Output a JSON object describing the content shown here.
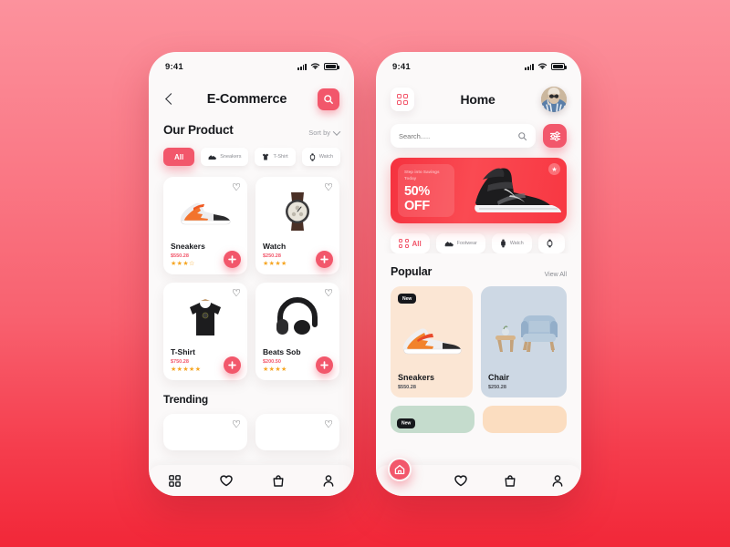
{
  "background": {
    "gradient_from": "#FC929D",
    "gradient_to": "#F22738"
  },
  "accent": "#F2576B",
  "star_color": "#F6A623",
  "left_phone": {
    "status_bar": {
      "time": "9:41",
      "signal_icon": "signal-bars-icon",
      "wifi_icon": "wifi-icon",
      "battery_icon": "battery-icon"
    },
    "header": {
      "back_icon": "chevron-left-icon",
      "title": "E-Commerce",
      "search_icon": "search-icon"
    },
    "section": {
      "title": "Our Product",
      "sort_label": "Sort by",
      "sort_chevron_icon": "chevron-down-icon"
    },
    "chips": [
      {
        "label": "All",
        "icon": "",
        "active": true
      },
      {
        "label": "Sneakers",
        "icon": "sneaker-icon",
        "active": false
      },
      {
        "label": "T-Shirt",
        "icon": "tshirt-icon",
        "active": false
      },
      {
        "label": "Watch",
        "icon": "watch-icon",
        "active": false
      }
    ],
    "products": [
      {
        "name": "Sneakers",
        "price": "$550.28",
        "stars": "★★★☆",
        "thumb": "sneaker-photo",
        "heart_icon": "heart-outline-icon",
        "add_icon": "plus-icon"
      },
      {
        "name": "Watch",
        "price": "$250.28",
        "stars": "★★★★",
        "thumb": "watch-photo",
        "heart_icon": "heart-outline-icon",
        "add_icon": "plus-icon"
      },
      {
        "name": "T-Shirt",
        "price": "$750.28",
        "stars": "★★★★★",
        "thumb": "tshirt-photo",
        "heart_icon": "heart-outline-icon",
        "add_icon": "plus-icon"
      },
      {
        "name": "Beats Sob",
        "price": "$200.50",
        "stars": "★★★★",
        "thumb": "headphones-photo",
        "heart_icon": "heart-outline-icon",
        "add_icon": "plus-icon"
      }
    ],
    "trending_title": "Trending",
    "bottom_nav": [
      {
        "icon": "grid-icon",
        "active": false
      },
      {
        "icon": "heart-icon",
        "active": false
      },
      {
        "icon": "bag-icon",
        "active": false
      },
      {
        "icon": "person-icon",
        "active": false
      }
    ]
  },
  "right_phone": {
    "status_bar": {
      "time": "9:41",
      "signal_icon": "signal-bars-icon",
      "wifi_icon": "wifi-icon",
      "battery_icon": "battery-icon"
    },
    "header": {
      "grid_icon": "grid-menu-icon",
      "title": "Home",
      "avatar": "user-avatar"
    },
    "search": {
      "placeholder": "Search.....",
      "value": "",
      "search_icon": "search-icon",
      "filter_icon": "filter-sliders-icon"
    },
    "banner": {
      "subtitle": "Step into Savings Today",
      "offer": "50% OFF",
      "star_icon": "star-icon",
      "product": "black-sneaker-photo"
    },
    "chips": [
      {
        "label": "All",
        "icon": "grid-icon",
        "active": true
      },
      {
        "label": "Footwear",
        "icon": "sneaker-icon",
        "active": false
      },
      {
        "label": "Watch",
        "icon": "watch-filled-icon",
        "active": false
      },
      {
        "label": "",
        "icon": "watch-icon",
        "active": false
      }
    ],
    "popular": {
      "title": "Popular",
      "view_all": "View All"
    },
    "popular_items": [
      {
        "name": "Sneakers",
        "price": "$550.28",
        "badge": "New",
        "bg": "#FBE6D4",
        "thumb": "orange-sneaker-photo"
      },
      {
        "name": "Chair",
        "price": "$250.28",
        "badge": "",
        "bg": "#CDD8E4",
        "thumb": "blue-chair-photo"
      }
    ],
    "popular_peek": [
      {
        "badge": "New",
        "bg": "#C5DCCD"
      },
      {
        "badge": "",
        "bg": "#FBDDC0"
      }
    ],
    "bottom_nav": [
      {
        "icon": "home-icon",
        "active": true
      },
      {
        "icon": "heart-icon",
        "active": false
      },
      {
        "icon": "bag-icon",
        "active": false
      },
      {
        "icon": "person-icon",
        "active": false
      }
    ]
  }
}
